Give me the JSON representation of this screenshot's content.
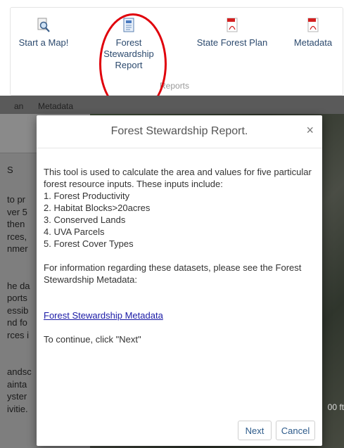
{
  "ribbon": {
    "tools": {
      "start_map": "Start a Map!",
      "forest_stewardship_report": "Forest Stewardship Report",
      "state_forest_plan": "State Forest Plan",
      "metadata": "Metadata"
    },
    "group_label": "Reports",
    "highlight_color": "#e0000b"
  },
  "background": {
    "tabs": [
      "an",
      "Metadata"
    ],
    "panel_header": "S",
    "panel_lines": [
      "to pr",
      "ver 5",
      "then",
      "rces,",
      "nmer",
      "",
      "",
      "he da",
      "ports",
      "essib",
      "nd fo",
      "rces i",
      "",
      "",
      "andsc",
      "ainta",
      "yster",
      "ivitie."
    ],
    "scale_text": "00 ft"
  },
  "modal": {
    "title": "Forest Stewardship Report.",
    "close_symbol": "×",
    "intro": "This tool is used to calculate the area and values for five particular forest resource inputs. These inputs include:",
    "items": [
      "1. Forest Productivity",
      "2. Habitat Blocks>20acres",
      "3. Conserved Lands",
      "4. UVA Parcels",
      "5. Forest Cover Types"
    ],
    "info": "For information regarding these datasets, please see the Forest Stewardship Metadata:",
    "link": "Forest Stewardship Metadata",
    "continue": "To continue, click \"Next\"",
    "buttons": {
      "next": "Next",
      "cancel": "Cancel"
    }
  }
}
